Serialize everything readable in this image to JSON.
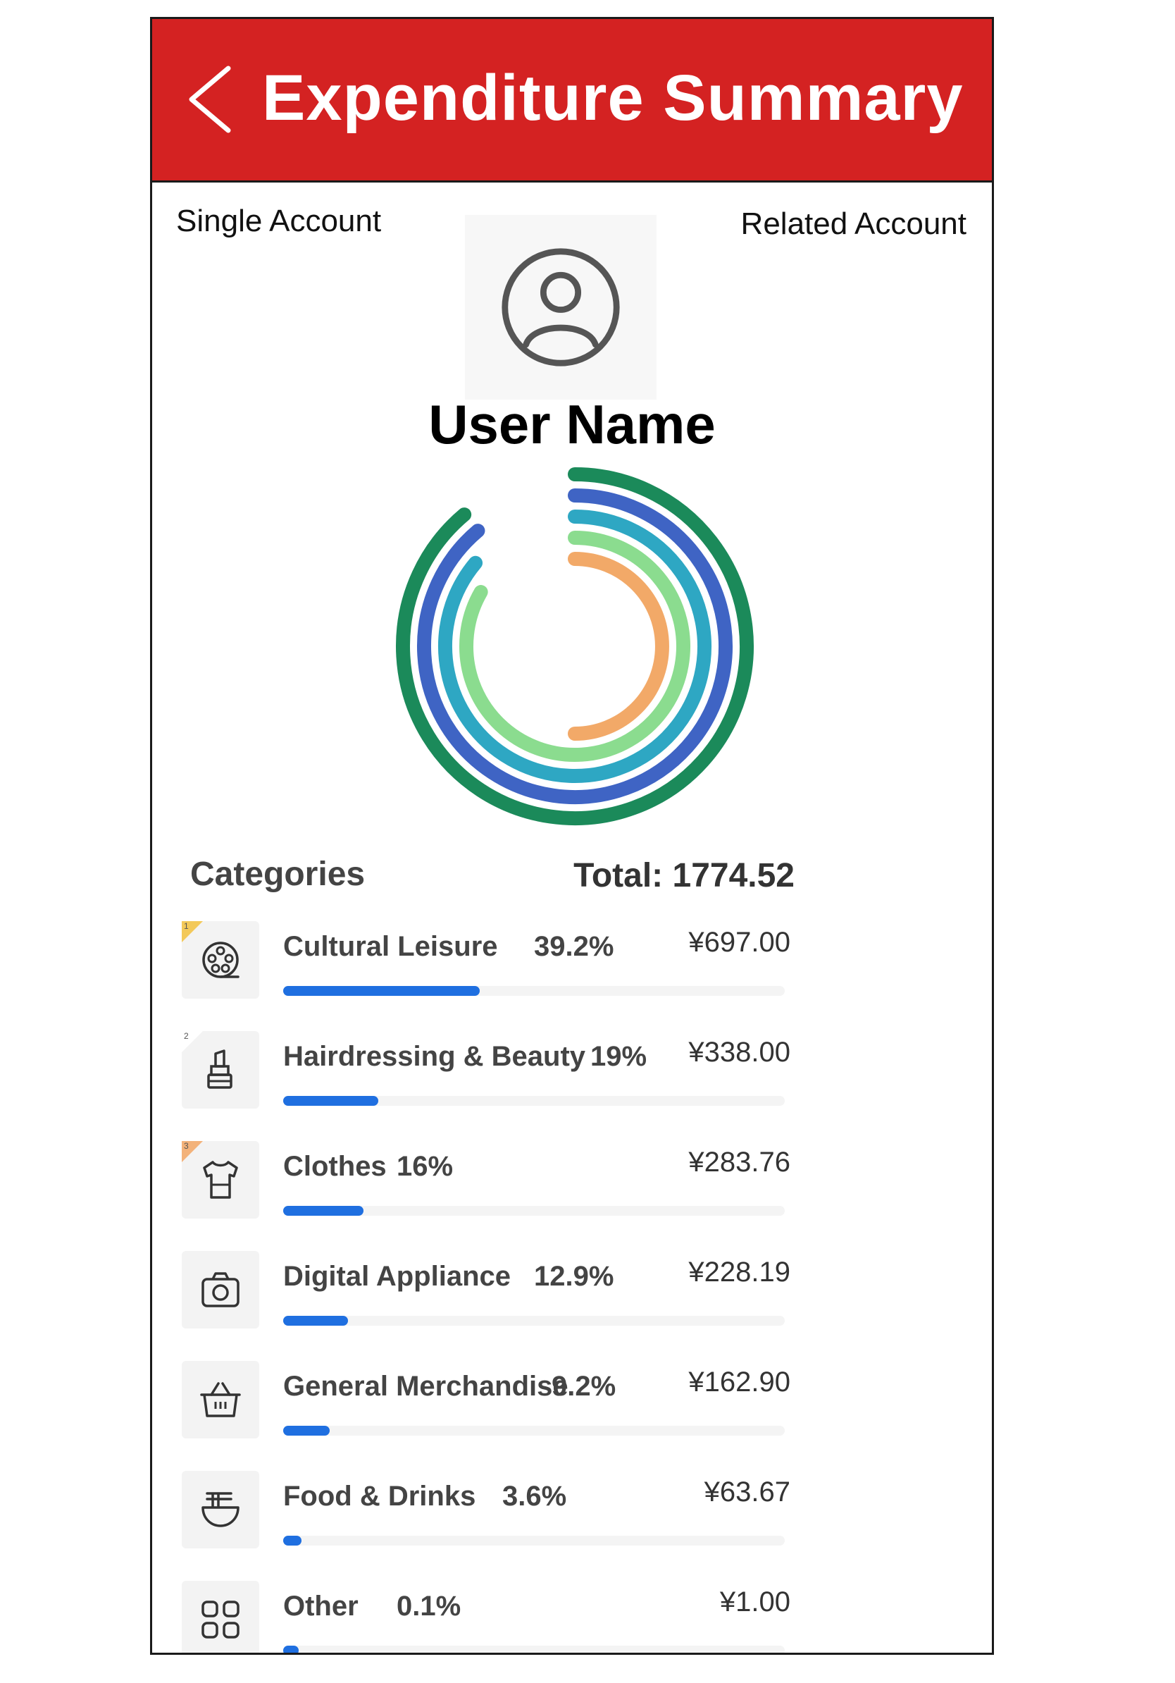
{
  "header": {
    "title": "Expenditure Summary",
    "bg_color": "#d42222",
    "back_icon": "chevron-left-icon"
  },
  "tabs": {
    "single": "Single Account",
    "related": "Related Account"
  },
  "profile": {
    "avatar_icon": "user-circle-icon",
    "name": "User Name"
  },
  "chart_data": {
    "type": "radial-bar",
    "title": "",
    "series": [
      {
        "name": "Cultural Leisure",
        "color": "#1b8a5a",
        "sweep_deg": 320
      },
      {
        "name": "Hairdressing & Beauty",
        "color": "#3f64c4",
        "sweep_deg": 320
      },
      {
        "name": "Clothes",
        "color": "#2ea7c3",
        "sweep_deg": 310
      },
      {
        "name": "Digital Appliance",
        "color": "#8bdc8f",
        "sweep_deg": 300
      },
      {
        "name": "General Merchandise",
        "color": "#f2a968",
        "sweep_deg": 180
      }
    ]
  },
  "categories": {
    "heading": "Categories",
    "total_label": "Total: 1774.52",
    "items": [
      {
        "name": "Cultural Leisure",
        "percent": "39.2%",
        "amount": "¥697.00",
        "fraction": 0.392,
        "icon": "film-reel-icon",
        "rank": "1",
        "rank_color": "#f3c95a"
      },
      {
        "name": "Hairdressing & Beauty",
        "percent": "19%",
        "amount": "¥338.00",
        "fraction": 0.19,
        "icon": "lipstick-icon",
        "rank": "2",
        "rank_color": "#ffffff"
      },
      {
        "name": "Clothes",
        "percent": "16%",
        "amount": "¥283.76",
        "fraction": 0.16,
        "icon": "shirt-icon",
        "rank": "3",
        "rank_color": "#f3b27a"
      },
      {
        "name": "Digital Appliance",
        "percent": "12.9%",
        "amount": "¥228.19",
        "fraction": 0.129,
        "icon": "camera-icon"
      },
      {
        "name": "General Merchandise",
        "percent": "9.2%",
        "amount": "¥162.90",
        "fraction": 0.092,
        "icon": "basket-icon"
      },
      {
        "name": "Food & Drinks",
        "percent": "3.6%",
        "amount": "¥63.67",
        "fraction": 0.036,
        "icon": "noodle-bowl-icon"
      },
      {
        "name": "Other",
        "percent": "0.1%",
        "amount": "¥1.00",
        "fraction": 0.001,
        "icon": "grid-icon"
      }
    ]
  },
  "colors": {
    "progress": "#1f6fe0"
  }
}
